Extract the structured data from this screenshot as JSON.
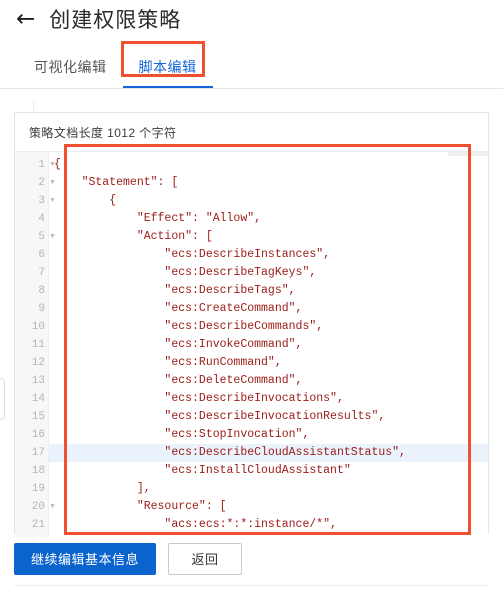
{
  "header": {
    "back_icon": "back-arrow-icon",
    "back_label": "←",
    "title": "创建权限策略"
  },
  "tabs": [
    {
      "label": "可视化编辑",
      "active": false
    },
    {
      "label": "脚本编辑",
      "active": true
    }
  ],
  "annotations": {
    "tab_box_color": "#ef5130",
    "code_box_color": "#ef5130"
  },
  "editor": {
    "doc_length_label": "策略文档长度 1012 个字符",
    "highlighted_line": 17,
    "fold_lines": [
      1,
      2,
      3,
      5,
      20
    ],
    "lines": [
      {
        "n": 1,
        "text": "{"
      },
      {
        "n": 2,
        "text": "    \"Statement\": ["
      },
      {
        "n": 3,
        "text": "        {"
      },
      {
        "n": 4,
        "text": "            \"Effect\": \"Allow\","
      },
      {
        "n": 5,
        "text": "            \"Action\": ["
      },
      {
        "n": 6,
        "text": "                \"ecs:DescribeInstances\","
      },
      {
        "n": 7,
        "text": "                \"ecs:DescribeTagKeys\","
      },
      {
        "n": 8,
        "text": "                \"ecs:DescribeTags\","
      },
      {
        "n": 9,
        "text": "                \"ecs:CreateCommand\","
      },
      {
        "n": 10,
        "text": "                \"ecs:DescribeCommands\","
      },
      {
        "n": 11,
        "text": "                \"ecs:InvokeCommand\","
      },
      {
        "n": 12,
        "text": "                \"ecs:RunCommand\","
      },
      {
        "n": 13,
        "text": "                \"ecs:DeleteCommand\","
      },
      {
        "n": 14,
        "text": "                \"ecs:DescribeInvocations\","
      },
      {
        "n": 15,
        "text": "                \"ecs:DescribeInvocationResults\","
      },
      {
        "n": 16,
        "text": "                \"ecs:StopInvocation\","
      },
      {
        "n": 17,
        "text": "                \"ecs:DescribeCloudAssistantStatus\","
      },
      {
        "n": 18,
        "text": "                \"ecs:InstallCloudAssistant\""
      },
      {
        "n": 19,
        "text": "            ],"
      },
      {
        "n": 20,
        "text": "            \"Resource\": ["
      },
      {
        "n": 21,
        "text": "                \"acs:ecs:*:*:instance/*\","
      }
    ]
  },
  "footer": {
    "primary_label": "继续编辑基本信息",
    "secondary_label": "返回"
  },
  "colors": {
    "accent": "#1565d8",
    "primary_button": "#0b63ce",
    "annotation": "#ef5130",
    "code_string": "#9b1b16",
    "active_line": "#eaf2fb"
  }
}
